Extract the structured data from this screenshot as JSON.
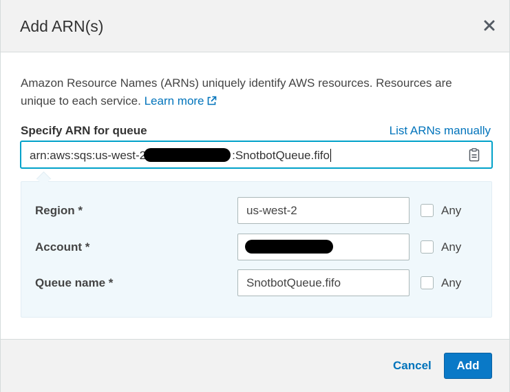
{
  "dialog": {
    "title": "Add ARN(s)",
    "close_icon": "close-icon"
  },
  "description": {
    "text": "Amazon Resource Names (ARNs) uniquely identify AWS resources. Resources are unique to each service.",
    "learn_more_label": "Learn more",
    "learn_more_icon": "external-link-icon"
  },
  "arn_field": {
    "label": "Specify ARN for queue",
    "list_manually_label": "List ARNs manually",
    "value_prefix": "arn:aws:sqs:us-west-2",
    "value_suffix": ":SnotbotQueue.fifo",
    "clipboard_icon": "clipboard-icon"
  },
  "details": {
    "rows": [
      {
        "label": "Region *",
        "value": "us-west-2",
        "any_label": "Any",
        "any_checked": false
      },
      {
        "label": "Account *",
        "value": "",
        "redacted": true,
        "any_label": "Any",
        "any_checked": false
      },
      {
        "label": "Queue name *",
        "value": "SnotbotQueue.fifo",
        "any_label": "Any",
        "any_checked": false
      }
    ]
  },
  "footer": {
    "cancel_label": "Cancel",
    "add_label": "Add"
  },
  "colors": {
    "link": "#0073bb",
    "primary_button": "#0a79c7",
    "focus_border": "#00a1c9",
    "panel_background": "#f0f8fc",
    "header_background": "#f2f2f2"
  }
}
